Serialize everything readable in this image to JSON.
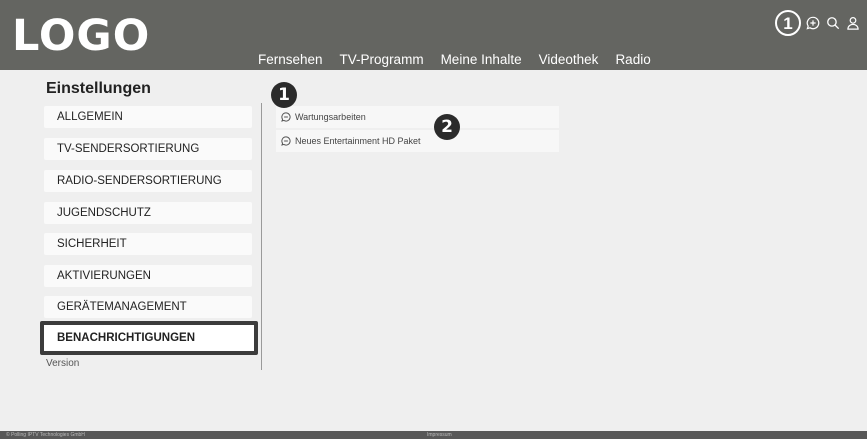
{
  "header": {
    "logo": "LOGO",
    "nav": [
      "Fernsehen",
      "TV-Programm",
      "Meine Inhalte",
      "Videothek",
      "Radio"
    ],
    "badge": "1",
    "icons": [
      "message-plus-icon",
      "search-icon",
      "user-icon"
    ]
  },
  "settings": {
    "title": "Einstellungen",
    "items": [
      {
        "label": "ALLGEMEIN"
      },
      {
        "label": "TV-SENDERSORTIERUNG"
      },
      {
        "label": "RADIO-SENDERSORTIERUNG"
      },
      {
        "label": "JUGENDSCHUTZ"
      },
      {
        "label": "SICHERHEIT"
      },
      {
        "label": "AKTIVIERUNGEN"
      },
      {
        "label": "GERÄTEMANAGEMENT"
      },
      {
        "label": "BENACHRICHTIGUNGEN",
        "active": true
      }
    ],
    "version_label": "Version"
  },
  "notifications": [
    {
      "label": "Wartungsarbeiten",
      "icon": "message-icon"
    },
    {
      "label": "Neues Entertainment HD Paket",
      "icon": "message-icon"
    }
  ],
  "callouts": [
    "1",
    "2"
  ],
  "footer": {
    "left": "© Polling IPTV Technologies GmbH",
    "center": "Impressum"
  },
  "colors": {
    "header_bg": "#646561",
    "page_bg": "#efefef",
    "item_bg": "#fafafa",
    "active_border": "#3c3c3c",
    "footer_bg": "#585858"
  }
}
